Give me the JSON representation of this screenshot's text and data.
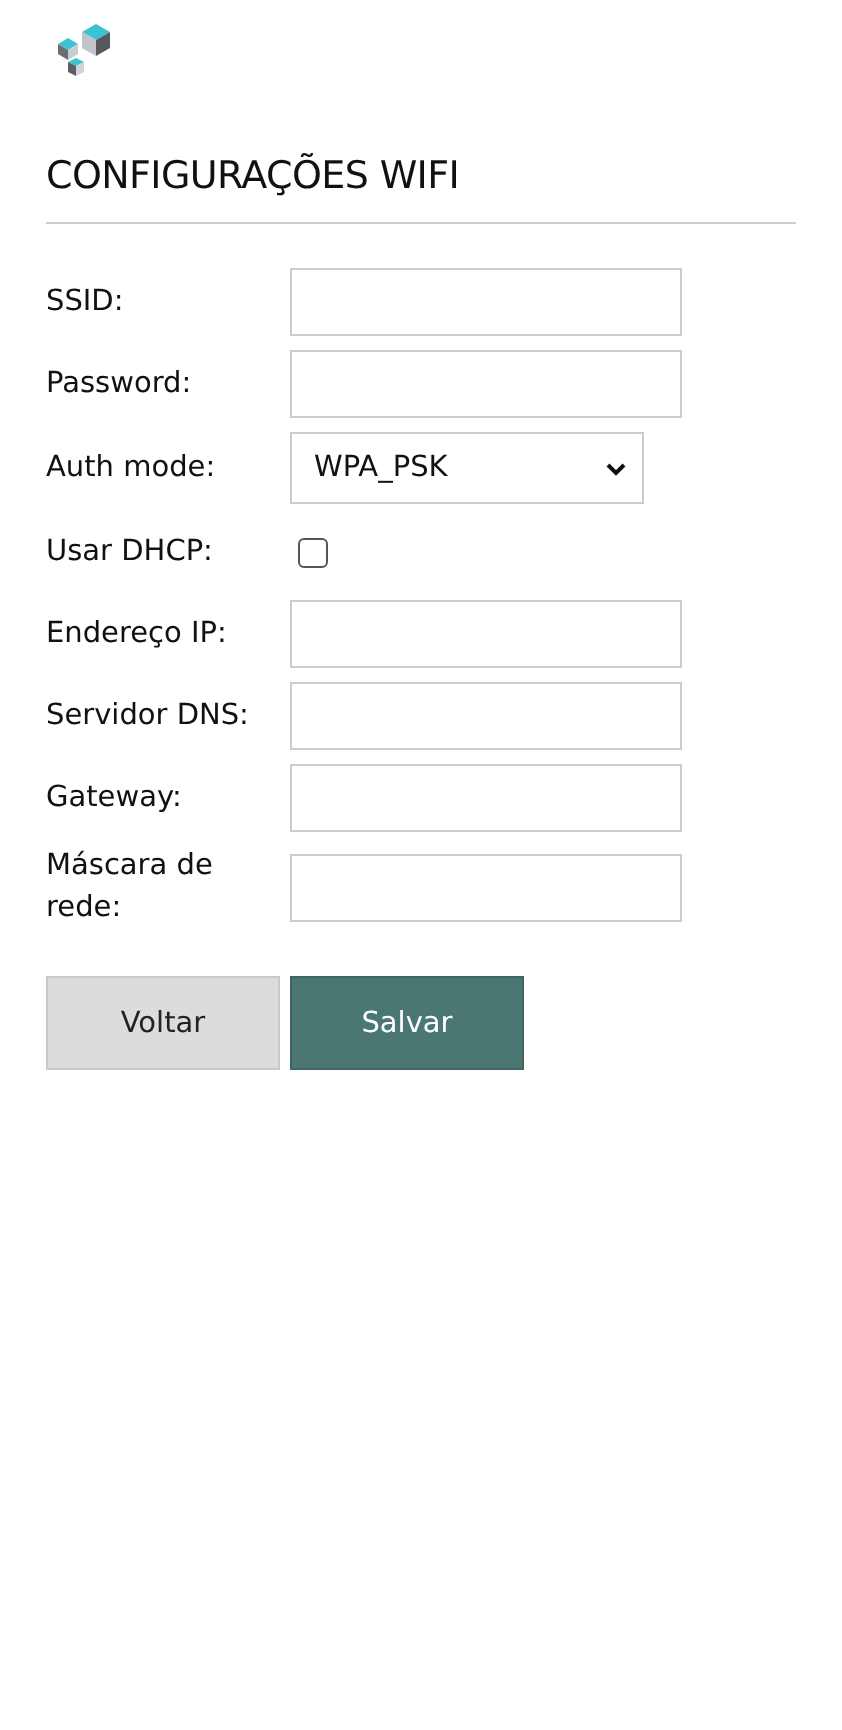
{
  "title": "CONFIGURAÇÕES WIFI",
  "fields": [
    {
      "kind": "text",
      "label": "SSID:"
    },
    {
      "kind": "text",
      "label": "Password:"
    },
    {
      "kind": "select",
      "label": "Auth mode:",
      "value": "WPA_PSK"
    },
    {
      "kind": "checkbox",
      "label": "Usar DHCP:",
      "checked": false
    },
    {
      "kind": "text",
      "label": "Endereço IP:"
    },
    {
      "kind": "text",
      "label": "Servidor DNS:"
    },
    {
      "kind": "text",
      "label": "Gateway:"
    },
    {
      "kind": "text",
      "label": "Máscara de rede:"
    }
  ],
  "buttons": [
    {
      "kind": "secondary",
      "label": "Voltar"
    },
    {
      "kind": "primary",
      "label": "Salvar"
    }
  ]
}
